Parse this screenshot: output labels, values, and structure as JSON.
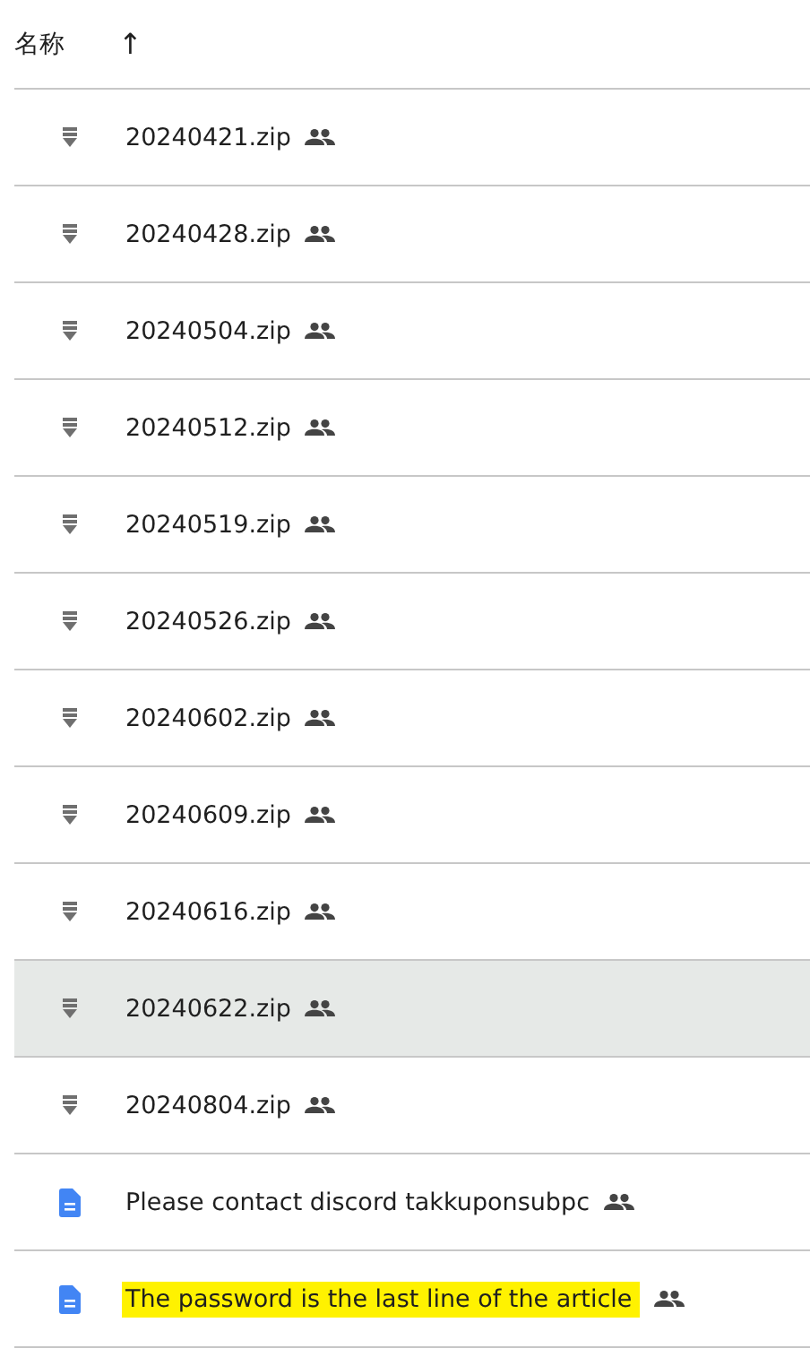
{
  "header": {
    "column": "名称",
    "sort_arrow": "↑"
  },
  "files": [
    {
      "kind": "zip",
      "name": "20240421.zip",
      "shared": true,
      "selected": false,
      "highlighted": false
    },
    {
      "kind": "zip",
      "name": "20240428.zip",
      "shared": true,
      "selected": false,
      "highlighted": false
    },
    {
      "kind": "zip",
      "name": "20240504.zip",
      "shared": true,
      "selected": false,
      "highlighted": false
    },
    {
      "kind": "zip",
      "name": "20240512.zip",
      "shared": true,
      "selected": false,
      "highlighted": false
    },
    {
      "kind": "zip",
      "name": "20240519.zip",
      "shared": true,
      "selected": false,
      "highlighted": false
    },
    {
      "kind": "zip",
      "name": "20240526.zip",
      "shared": true,
      "selected": false,
      "highlighted": false
    },
    {
      "kind": "zip",
      "name": "20240602.zip",
      "shared": true,
      "selected": false,
      "highlighted": false
    },
    {
      "kind": "zip",
      "name": "20240609.zip",
      "shared": true,
      "selected": false,
      "highlighted": false
    },
    {
      "kind": "zip",
      "name": "20240616.zip",
      "shared": true,
      "selected": false,
      "highlighted": false
    },
    {
      "kind": "zip",
      "name": "20240622.zip",
      "shared": true,
      "selected": true,
      "highlighted": false
    },
    {
      "kind": "zip",
      "name": "20240804.zip",
      "shared": true,
      "selected": false,
      "highlighted": false
    },
    {
      "kind": "doc",
      "name": "Please contact discord takkuponsubpc",
      "shared": true,
      "selected": false,
      "highlighted": false
    },
    {
      "kind": "doc",
      "name": "The password is the last line of the article",
      "shared": true,
      "selected": false,
      "highlighted": true
    }
  ]
}
